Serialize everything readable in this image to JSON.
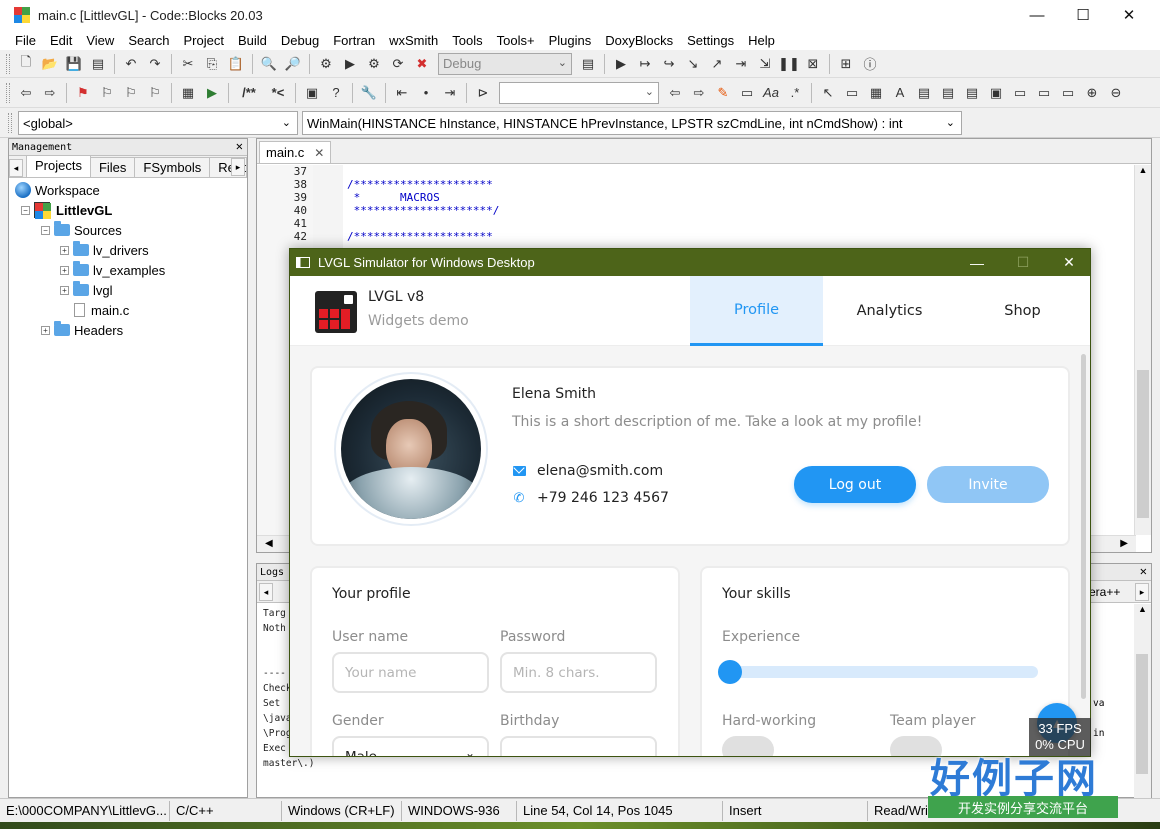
{
  "window": {
    "title": "main.c [LittlevGL] - Code::Blocks 20.03",
    "minimize": "—",
    "maximize": "☐",
    "close": "✕"
  },
  "menu": [
    "File",
    "Edit",
    "View",
    "Search",
    "Project",
    "Build",
    "Debug",
    "Fortran",
    "wxSmith",
    "Tools",
    "Tools+",
    "Plugins",
    "DoxyBlocks",
    "Settings",
    "Help"
  ],
  "toolbar": {
    "build_target": "Debug",
    "comment_label": "/**",
    "star_label": "*<"
  },
  "scope": {
    "global": "<global>",
    "function": "WinMain(HINSTANCE hInstance, HINSTANCE hPrevInstance, LPSTR szCmdLine, int nCmdShow) : int"
  },
  "management": {
    "title": "Management",
    "tabs": [
      "Projects",
      "Files",
      "FSymbols",
      "Reso"
    ],
    "tree": {
      "workspace": "Workspace",
      "project": "LittlevGL",
      "sources": "Sources",
      "lv_drivers": "lv_drivers",
      "lv_examples": "lv_examples",
      "lvgl": "lvgl",
      "main_c": "main.c",
      "headers": "Headers"
    }
  },
  "editor": {
    "tab": "main.c",
    "line_numbers": [
      "37",
      "38",
      "39",
      "40",
      "41",
      "42"
    ],
    "code_lines": [
      "",
      "/*********************",
      " *      MACROS",
      " *********************/",
      "",
      "/*********************"
    ]
  },
  "logs": {
    "title": "Logs",
    "tab_right": "era++",
    "lines": [
      "Targ",
      "Noth",
      "",
      "",
      "----",
      "Check",
      "Set ",
      "\\java",
      "\\Prog",
      "Exec",
      "master\\.)"
    ],
    "right_col": [
      "va",
      "",
      "in"
    ]
  },
  "status": {
    "path": "E:\\000COMPANY\\LittlevG...",
    "lang": "C/C++",
    "eol": "Windows (CR+LF)",
    "encoding": "WINDOWS-936",
    "position": "Line 54, Col 14, Pos 1045",
    "mode": "Insert",
    "access": "Read/Writ"
  },
  "lvgl": {
    "title": "LVGL Simulator for Windows Desktop",
    "brand_name": "LVGL v8",
    "brand_sub": "Widgets demo",
    "tabs": [
      "Profile",
      "Analytics",
      "Shop"
    ],
    "profile": {
      "name": "Elena Smith",
      "description": "This is a short description of me. Take a look at my profile!",
      "email": "elena@smith.com",
      "phone": "+79 246 123 4567",
      "logout": "Log out",
      "invite": "Invite"
    },
    "your_profile": {
      "title": "Your profile",
      "username_label": "User name",
      "username_placeholder": "Your name",
      "password_label": "Password",
      "password_placeholder": "Min. 8 chars.",
      "gender_label": "Gender",
      "gender_value": "Male",
      "birthday_label": "Birthday"
    },
    "your_skills": {
      "title": "Your skills",
      "experience_label": "Experience",
      "experience_value": 0.0,
      "hardworking_label": "Hard-working",
      "teamplayer_label": "Team player"
    },
    "fps": "33 FPS",
    "cpu": "0% CPU"
  },
  "watermark": {
    "big": "好例子网",
    "small": "开发实例分享交流平台"
  },
  "colors": {
    "accent": "#2196f3",
    "sim_titlebar": "#4d6419"
  }
}
